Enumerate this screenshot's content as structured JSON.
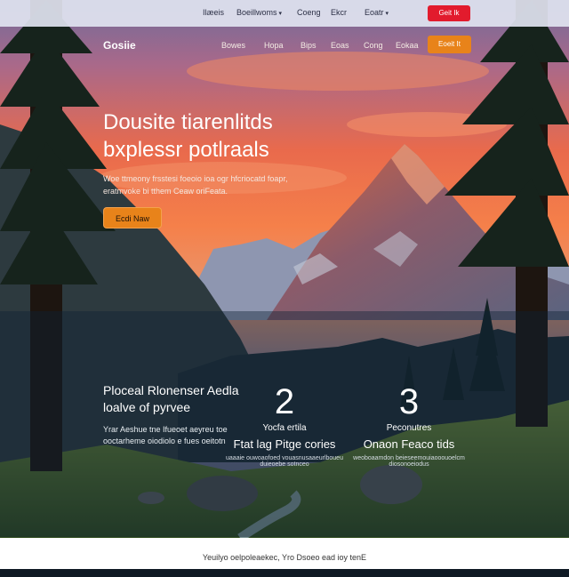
{
  "topbar": {
    "links": [
      "Ilæeis",
      "Boeillwoms",
      "Coeng",
      "Ekcr",
      "Eoatr"
    ],
    "cta": "Geit Ik"
  },
  "nav": {
    "brand": "Gosiie",
    "links": [
      "Bowes",
      "Hopa",
      "Bips",
      "Eoas",
      "Cong",
      "Eokaa"
    ],
    "cta": "Eoeit It"
  },
  "hero": {
    "title_line1": "Dousite tiarenlitds",
    "title_line2": "bxplessr potlraals",
    "subtitle": "Woe ttmeony frsstesi foeoio ioa ogr hfcriocatd foapr, eratmvoke bi tthem Ceaw oriFeata.",
    "cta": "Ecdi Naw"
  },
  "stats": {
    "heading_line1": "Ploceal Rlonenser Aedla",
    "heading_line2": "loalve of pyrvee",
    "body": "Yrar Aeshue tne Ifueoet aeyreu toe ooctarheme oiodiolo e fues oeitotn",
    "items": [
      {
        "number": "2",
        "label": "Yocfa ertila",
        "title": "Ftat lag Pitge cories",
        "small": "uaaaie ouwoaofoed vouasnusaaeurlboueu\nduieoebe sotnceo"
      },
      {
        "number": "3",
        "label": "Peconutres",
        "title": "Onaon Feaco tids",
        "small": "weoboaamdon beieseemouiaooouoelcm\ndiosonoeiodus"
      }
    ]
  },
  "footer": {
    "text": "Yeuilyo oelpoleaekec, Yro Dsoeo ead ioy tenE"
  }
}
